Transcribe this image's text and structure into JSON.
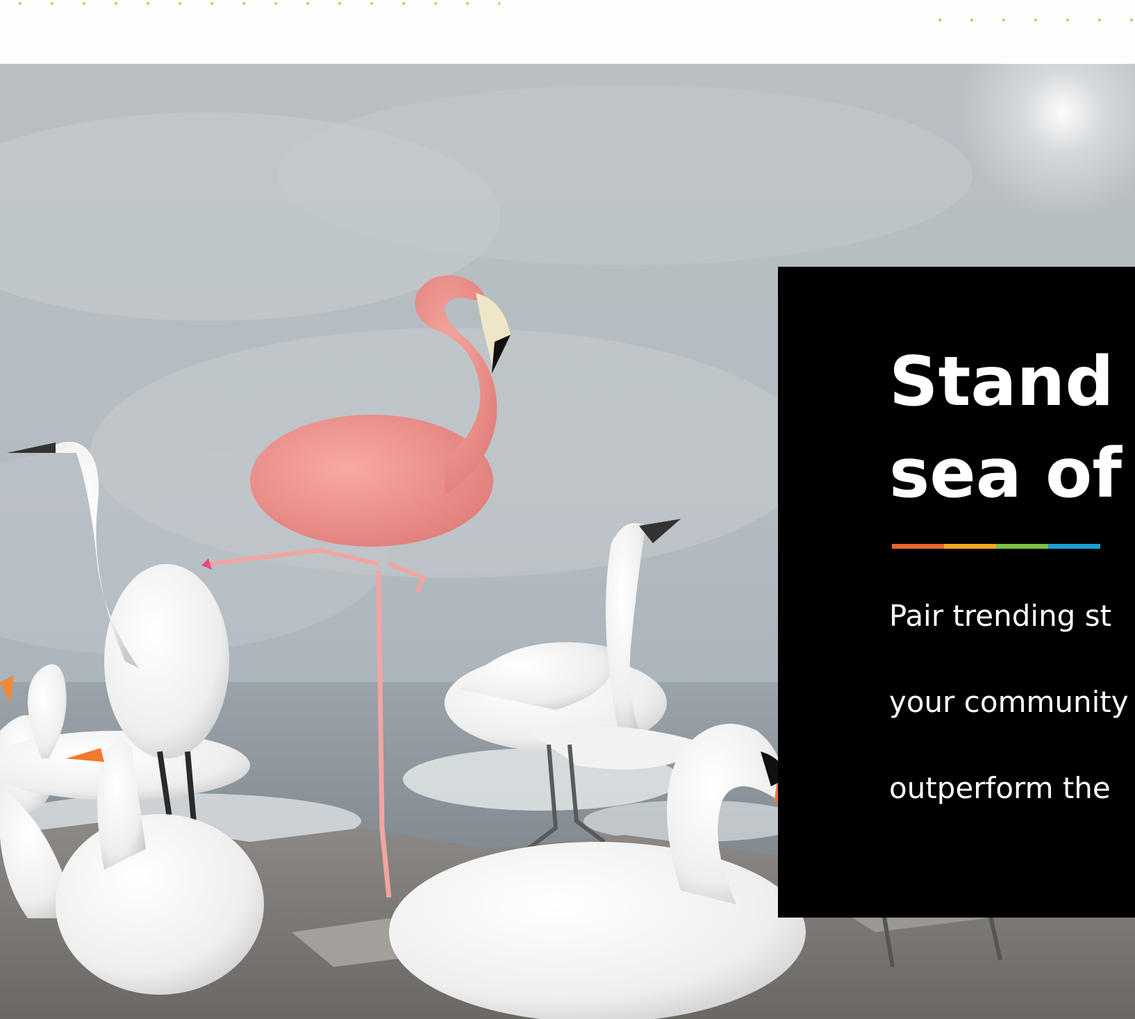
{
  "hero": {
    "image_alt": "A pink flamingo standing on one leg among white swans, egrets and geese on rocky shore under a grey sky",
    "headline_lines": [
      "Stand o",
      "sea of s"
    ],
    "body_lines": [
      "Pair trending st",
      "your community",
      "outperform the"
    ]
  },
  "colors": {
    "panel_background": "#000000",
    "headline": "#ffffff",
    "rule": [
      "#e8672a",
      "#f5a623",
      "#7bc143",
      "#1b9fd4"
    ],
    "orange_dots": "#f0a35a",
    "green_dots": "#a8d06a"
  }
}
